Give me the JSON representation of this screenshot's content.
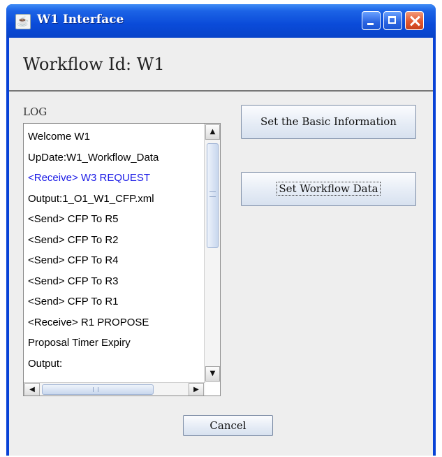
{
  "window": {
    "title": "W1 Interface",
    "colors": {
      "titlebar": "#0a4bd9",
      "client_bg": "#eeeeee",
      "highlight_text": "#1b1be6"
    }
  },
  "header": {
    "workflow_label": "Workflow Id: W1"
  },
  "log": {
    "label": "LOG",
    "lines": [
      {
        "text": "Welcome W1"
      },
      {
        "text": "UpDate:W1_Workflow_Data"
      },
      {
        "text": "<Receive> W3 REQUEST"
      },
      {
        "text": "Output:1_O1_W1_CFP.xml"
      },
      {
        "text": "<Send> CFP To R5"
      },
      {
        "text": "<Send> CFP To R2"
      },
      {
        "text": "<Send> CFP To R4"
      },
      {
        "text": "<Send> CFP To R3"
      },
      {
        "text": "<Send> CFP To R1"
      },
      {
        "text": "<Receive> R1 PROPOSE"
      },
      {
        "text": "Proposal Timer Expiry"
      },
      {
        "text": "Output:"
      }
    ]
  },
  "buttons": {
    "basic_info": "Set the Basic Information",
    "workflow_data": "Set Workflow Data",
    "cancel": "Cancel"
  },
  "icons": {
    "app": "java-cup-icon",
    "minimize": "minimize-icon",
    "maximize": "maximize-icon",
    "close": "close-icon"
  }
}
